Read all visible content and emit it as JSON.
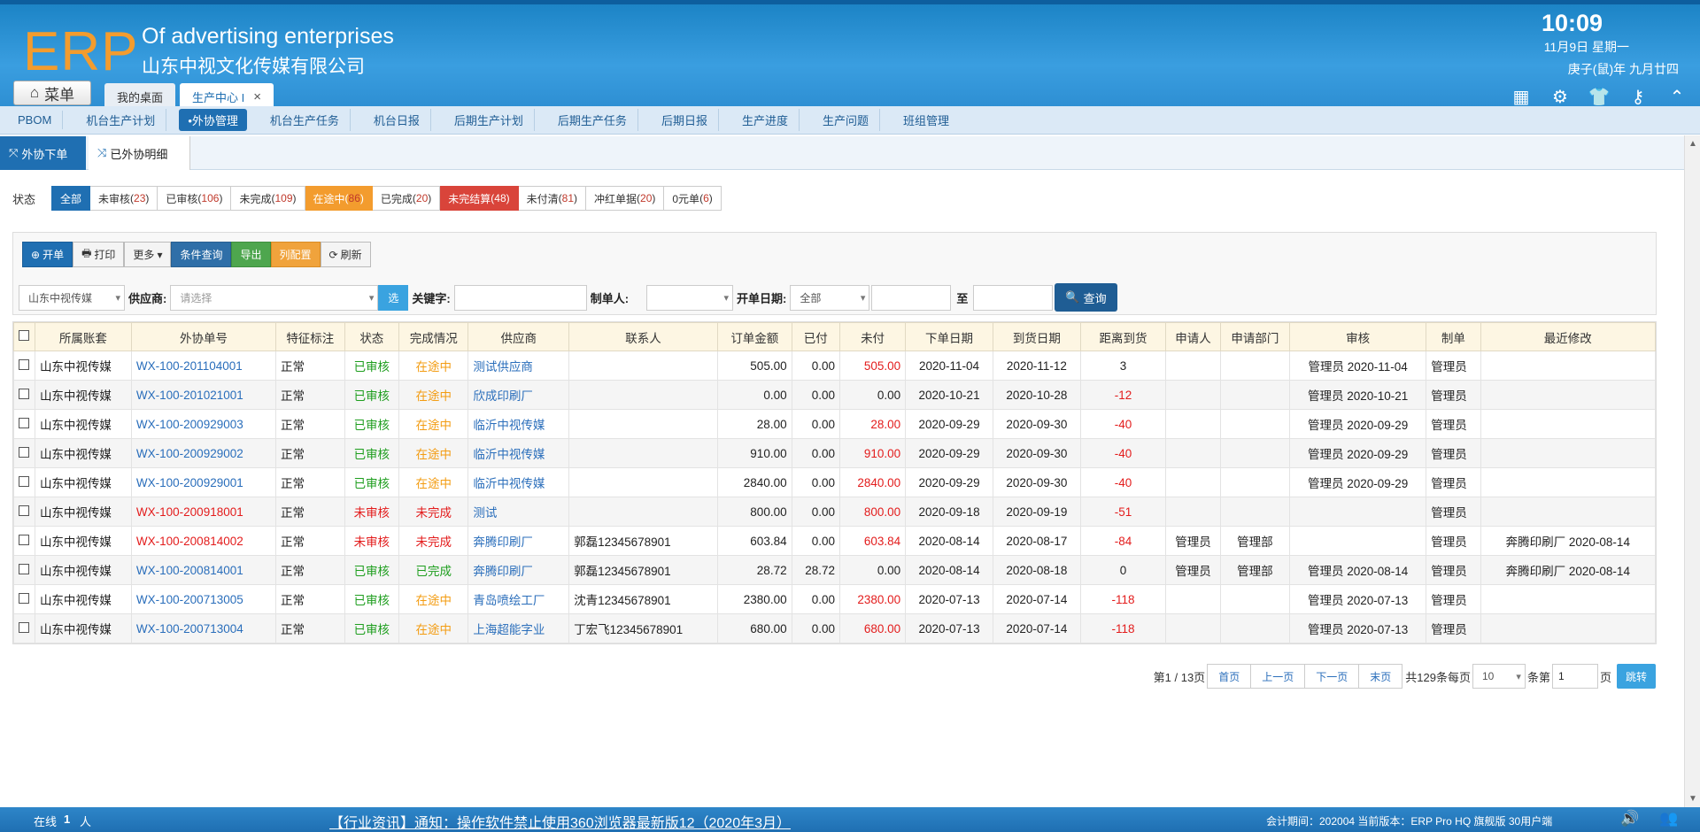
{
  "header": {
    "logo": "ERP",
    "slogan": "Of advertising enterprises",
    "company": "山东中视文化传媒有限公司",
    "time": "10:09",
    "date": "11月9日 星期一",
    "lunar": "庚子(鼠)年 九月廿四",
    "icons": [
      "grid-add-icon",
      "gear-icon",
      "shirt-icon",
      "key-icon",
      "chevron-up-icon"
    ]
  },
  "menu_label": "菜单",
  "window_tabs": [
    {
      "label": "我的桌面"
    },
    {
      "label": "生产中心 I",
      "close": "×"
    }
  ],
  "nav": [
    "PBOM",
    "机台生产计划",
    "•外协管理",
    "机台生产任务",
    "机台日报",
    "后期生产计划",
    "后期生产任务",
    "后期日报",
    "生产进度",
    "生产问题",
    "班组管理"
  ],
  "subtabs": [
    "外协下单",
    "已外协明细"
  ],
  "status": {
    "label": "状态",
    "items": [
      {
        "label": "全部",
        "count": "",
        "bg": "#1f6fb2",
        "fg": "#ffffff"
      },
      {
        "label": "未审核",
        "count": "23",
        "bg": "",
        "fg": ""
      },
      {
        "label": "已审核",
        "count": "106",
        "bg": "",
        "fg": ""
      },
      {
        "label": "未完成",
        "count": "109",
        "bg": "",
        "fg": ""
      },
      {
        "label": "在途中",
        "count": "86",
        "bg": "#f39c2e",
        "fg": "#ffffff"
      },
      {
        "label": "已完成",
        "count": "20",
        "bg": "",
        "fg": ""
      },
      {
        "label": "未完结算",
        "count": "48",
        "bg": "#d9443a",
        "fg": "#ffffff"
      },
      {
        "label": "未付清",
        "count": "81",
        "bg": "",
        "fg": ""
      },
      {
        "label": "冲红单据",
        "count": "20",
        "bg": "",
        "fg": ""
      },
      {
        "label": "0元单",
        "count": "6",
        "bg": "",
        "fg": ""
      }
    ]
  },
  "toolbar": {
    "open": "开单",
    "print": "打印",
    "more": "更多",
    "query": "条件查询",
    "export": "导出",
    "columns": "列配置",
    "refresh": "刷新"
  },
  "filter": {
    "account": "山东中视传媒",
    "supplier_label": "供应商:",
    "supplier_placeholder": "请选择",
    "select_btn": "选",
    "keyword_label": "关键字:",
    "maker_label": "制单人:",
    "date_label": "开单日期:",
    "date_option": "全部",
    "to_label": "至",
    "search_btn": "查询"
  },
  "table": {
    "headers": [
      "所属账套",
      "外协单号",
      "特征标注",
      "状态",
      "完成情况",
      "供应商",
      "联系人",
      "订单金额",
      "已付",
      "未付",
      "下单日期",
      "到货日期",
      "距离到货",
      "申请人",
      "申请部门",
      "审核",
      "制单",
      "最近修改"
    ],
    "rows": [
      {
        "account": "山东中视传媒",
        "no": "WX-100-201104001",
        "tag": "正常",
        "status": "已审核",
        "done": "在途中",
        "supplier": "测试供应商",
        "contact": "",
        "amount": "505.00",
        "paid": "0.00",
        "unpaid": "505.00",
        "order_date": "2020-11-04",
        "arrive_date": "2020-11-12",
        "dist": "3",
        "applicant": "",
        "dept": "",
        "audit": "管理员 2020-11-04",
        "maker": "管理员",
        "modified": ""
      },
      {
        "account": "山东中视传媒",
        "no": "WX-100-201021001",
        "tag": "正常",
        "status": "已审核",
        "done": "在途中",
        "supplier": "欣成印刷厂",
        "contact": "",
        "amount": "0.00",
        "paid": "0.00",
        "unpaid": "0.00",
        "order_date": "2020-10-21",
        "arrive_date": "2020-10-28",
        "dist": "-12",
        "applicant": "",
        "dept": "",
        "audit": "管理员 2020-10-21",
        "maker": "管理员",
        "modified": ""
      },
      {
        "account": "山东中视传媒",
        "no": "WX-100-200929003",
        "tag": "正常",
        "status": "已审核",
        "done": "在途中",
        "supplier": "临沂中视传媒",
        "contact": "",
        "amount": "28.00",
        "paid": "0.00",
        "unpaid": "28.00",
        "order_date": "2020-09-29",
        "arrive_date": "2020-09-30",
        "dist": "-40",
        "applicant": "",
        "dept": "",
        "audit": "管理员 2020-09-29",
        "maker": "管理员",
        "modified": ""
      },
      {
        "account": "山东中视传媒",
        "no": "WX-100-200929002",
        "tag": "正常",
        "status": "已审核",
        "done": "在途中",
        "supplier": "临沂中视传媒",
        "contact": "",
        "amount": "910.00",
        "paid": "0.00",
        "unpaid": "910.00",
        "order_date": "2020-09-29",
        "arrive_date": "2020-09-30",
        "dist": "-40",
        "applicant": "",
        "dept": "",
        "audit": "管理员 2020-09-29",
        "maker": "管理员",
        "modified": ""
      },
      {
        "account": "山东中视传媒",
        "no": "WX-100-200929001",
        "tag": "正常",
        "status": "已审核",
        "done": "在途中",
        "supplier": "临沂中视传媒",
        "contact": "",
        "amount": "2840.00",
        "paid": "0.00",
        "unpaid": "2840.00",
        "order_date": "2020-09-29",
        "arrive_date": "2020-09-30",
        "dist": "-40",
        "applicant": "",
        "dept": "",
        "audit": "管理员 2020-09-29",
        "maker": "管理员",
        "modified": ""
      },
      {
        "account": "山东中视传媒",
        "no": "WX-100-200918001",
        "tag": "正常",
        "status": "未审核",
        "done": "未完成",
        "supplier": "测试",
        "contact": "",
        "amount": "800.00",
        "paid": "0.00",
        "unpaid": "800.00",
        "order_date": "2020-09-18",
        "arrive_date": "2020-09-19",
        "dist": "-51",
        "applicant": "",
        "dept": "",
        "audit": "",
        "maker": "管理员",
        "modified": ""
      },
      {
        "account": "山东中视传媒",
        "no": "WX-100-200814002",
        "tag": "正常",
        "status": "未审核",
        "done": "未完成",
        "supplier": "奔腾印刷厂",
        "contact": "郭磊12345678901",
        "amount": "603.84",
        "paid": "0.00",
        "unpaid": "603.84",
        "order_date": "2020-08-14",
        "arrive_date": "2020-08-17",
        "dist": "-84",
        "applicant": "管理员",
        "dept": "管理部",
        "audit": "",
        "maker": "管理员",
        "modified": "奔腾印刷厂 2020-08-14"
      },
      {
        "account": "山东中视传媒",
        "no": "WX-100-200814001",
        "tag": "正常",
        "status": "已审核",
        "done": "已完成",
        "supplier": "奔腾印刷厂",
        "contact": "郭磊12345678901",
        "amount": "28.72",
        "paid": "28.72",
        "unpaid": "0.00",
        "order_date": "2020-08-14",
        "arrive_date": "2020-08-18",
        "dist": "0",
        "applicant": "管理员",
        "dept": "管理部",
        "audit": "管理员 2020-08-14",
        "maker": "管理员",
        "modified": "奔腾印刷厂 2020-08-14"
      },
      {
        "account": "山东中视传媒",
        "no": "WX-100-200713005",
        "tag": "正常",
        "status": "已审核",
        "done": "在途中",
        "supplier": "青岛喷绘工厂",
        "contact": "沈青12345678901",
        "amount": "2380.00",
        "paid": "0.00",
        "unpaid": "2380.00",
        "order_date": "2020-07-13",
        "arrive_date": "2020-07-14",
        "dist": "-118",
        "applicant": "",
        "dept": "",
        "audit": "管理员 2020-07-13",
        "maker": "管理员",
        "modified": ""
      },
      {
        "account": "山东中视传媒",
        "no": "WX-100-200713004",
        "tag": "正常",
        "status": "已审核",
        "done": "在途中",
        "supplier": "上海超能字业",
        "contact": "丁宏飞12345678901",
        "amount": "680.00",
        "paid": "0.00",
        "unpaid": "680.00",
        "order_date": "2020-07-13",
        "arrive_date": "2020-07-14",
        "dist": "-118",
        "applicant": "",
        "dept": "",
        "audit": "管理员 2020-07-13",
        "maker": "管理员",
        "modified": ""
      }
    ]
  },
  "pager": {
    "page_info": "第1 / 13页",
    "first": "首页",
    "prev": "上一页",
    "next": "下一页",
    "last": "末页",
    "total_prefix": "共129条每页",
    "per_page": "10",
    "goto_prefix": "条第",
    "goto_page": "1",
    "goto_suffix": "页",
    "goto_btn": "跳转"
  },
  "footer": {
    "online_label": "在线",
    "online_count": "1",
    "online_unit": "人",
    "notice": "【行业资讯】通知：操作软件禁止使用360浏览器最新版12（2020年3月）",
    "period": "会计期间：202004 当前版本：ERP Pro HQ 旗舰版 30用户端"
  }
}
